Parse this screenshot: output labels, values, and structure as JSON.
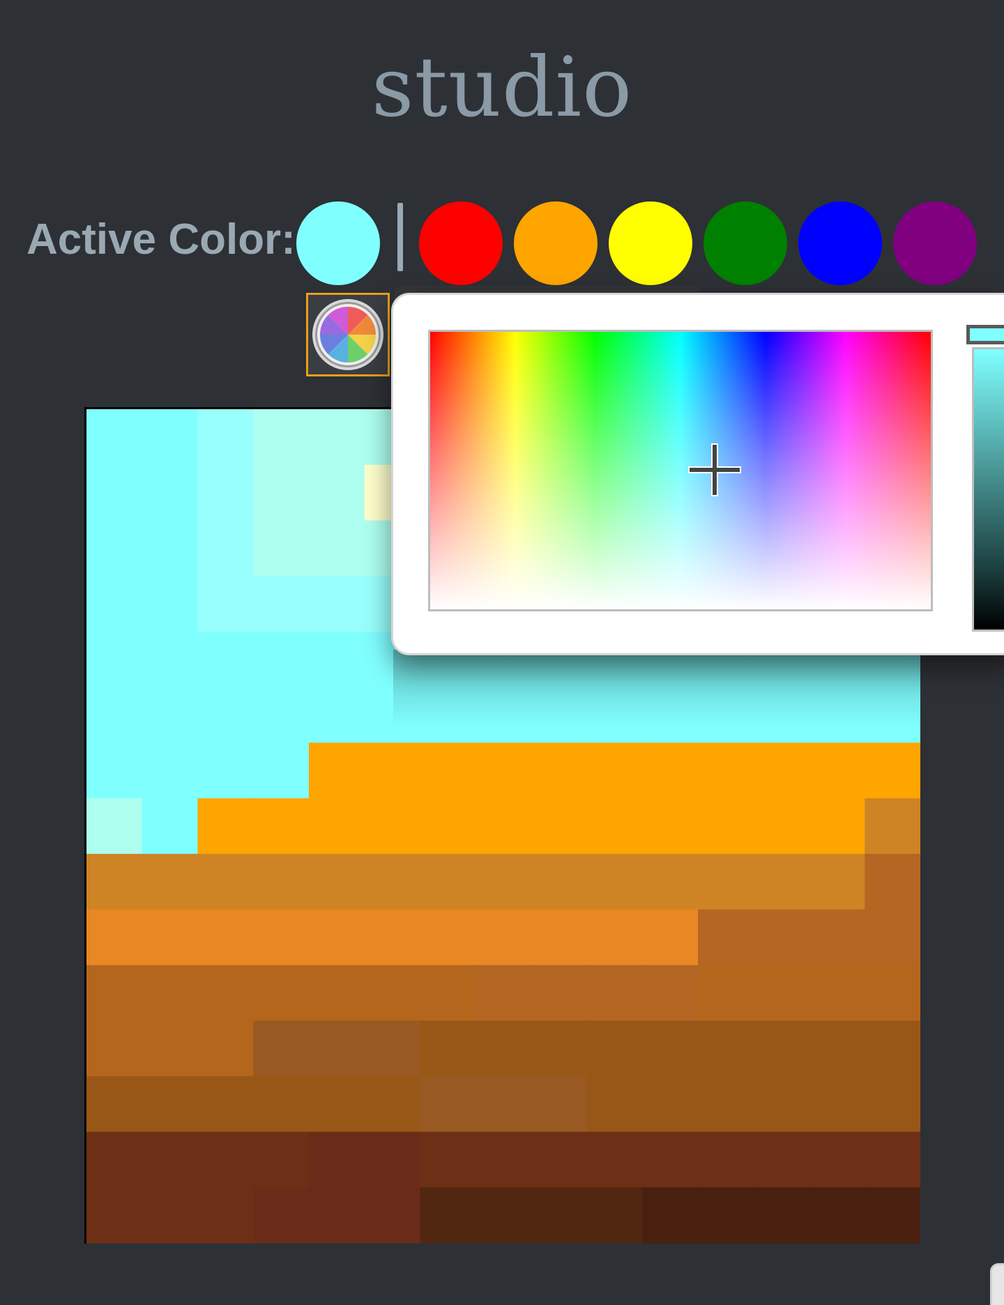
{
  "app": {
    "title": "studio"
  },
  "toolbar": {
    "active_color_label": "Active Color:",
    "active_color": "#80ffff",
    "palette": [
      {
        "name": "red",
        "color": "#ff0000"
      },
      {
        "name": "orange",
        "color": "#ffa500"
      },
      {
        "name": "yellow",
        "color": "#ffff00"
      },
      {
        "name": "green",
        "color": "#008000"
      },
      {
        "name": "blue",
        "color": "#0000ff"
      },
      {
        "name": "purple",
        "color": "#800080"
      }
    ],
    "custom_color_icon": "color-wheel-icon",
    "accent_color": "#e8a019"
  },
  "color_picker": {
    "open": true,
    "selected_color": "#80ffff"
  },
  "canvas": {
    "grid_cols": 15,
    "grid_rows": 15,
    "palette": {
      "A": "#80ffff",
      "B": "#99fffc",
      "C": "#aefff0",
      "D": "#ffffcc",
      "E": "#ffa500",
      "F": "#ce8424",
      "G": "#e98724",
      "H": "#b46622",
      "I": "#b5661d",
      "J": "#b56a1e",
      "K": "#985a22",
      "L": "#995717",
      "M": "#6d2f16",
      "N": "#6a2c18",
      "O": "#512712",
      "P": "#491f0f",
      "Q": "#6ed0d6"
    },
    "pixels": [
      "AABCCCCCCCCCCCC",
      "AABCCDCCCCCCCCC",
      "AABCCCCCCCCCCCC",
      "AABBBBBBBBBBBBB",
      "AAAAAAAAAAAAAAA",
      "AAAAAAAAAAAAAAA",
      "AAAAEEEEEEEEEEE",
      "CAEEEEEEEEEEEEF",
      "FFFFFFFFFFFFFFH",
      "GGGGGGGGGGGHHHH",
      "IIIIIIIHHHHIIII",
      "IIIKKKLLLLLLLLL",
      "LLLLLLKKKLLLLLL",
      "MMMMNNMMMMMMMMM",
      "MMMNNNOOOOPPPPP"
    ]
  }
}
